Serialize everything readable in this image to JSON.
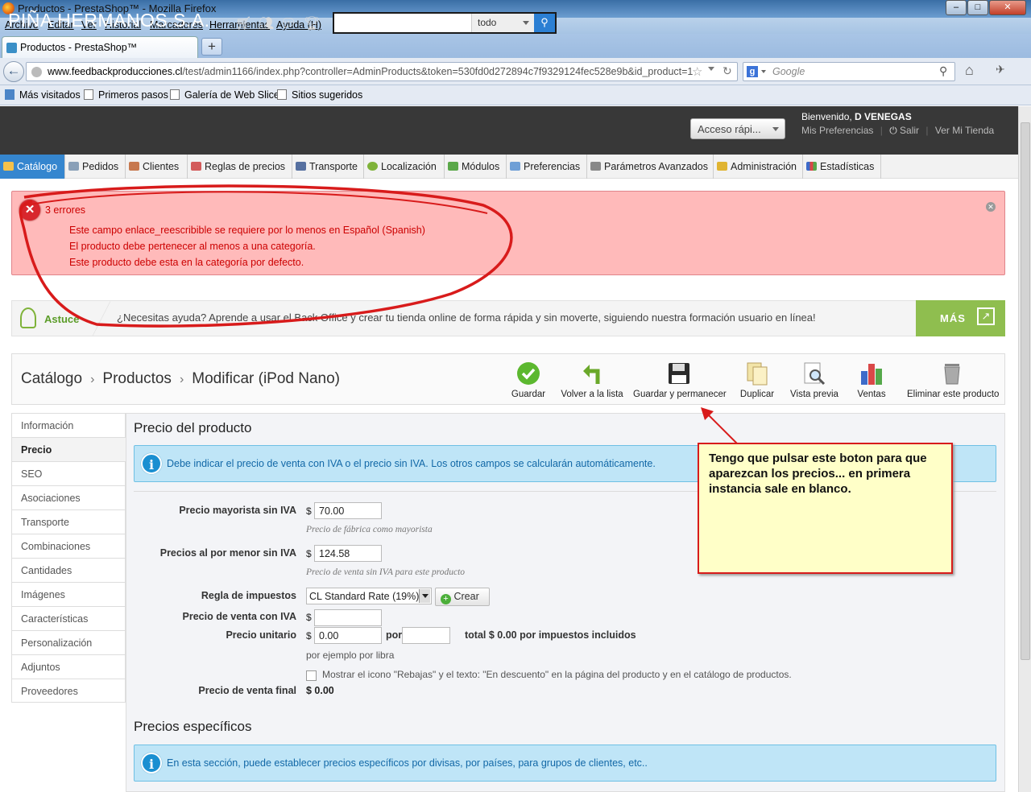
{
  "window": {
    "title": "Productos - PrestaShop™ - Mozilla Firefox"
  },
  "menu": [
    "Archivo",
    "Editar",
    "Ver",
    "Historial",
    "Marcadores",
    "Herramientas",
    "Ayuda (H)"
  ],
  "tab": {
    "label": "Productos - PrestaShop™",
    "new_tab": "+"
  },
  "url": {
    "host": "www.feedbackproducciones.cl",
    "path": "/test/admin1166/index.php?controller=AdminProducts&token=530fd0d272894c7f9329124fec528e9b&id_product=1"
  },
  "search": {
    "placeholder": "Google",
    "engine": "g"
  },
  "bookmarks": [
    "Más visitados",
    "Primeros pasos",
    "Galería de Web Slice",
    "Sitios sugeridos"
  ],
  "header": {
    "shop": "PIÑA HERMANOS S.A.",
    "search_scope": "todo",
    "quick_access": "Acceso rápi...",
    "welcome_prefix": "Bienvenido, ",
    "user": "D VENEGAS",
    "prefs": "Mis Preferencias",
    "logout": "Salir",
    "view_store": "Ver Mi Tienda"
  },
  "nav": [
    "Catálogo",
    "Pedidos",
    "Clientes",
    "Reglas de precios",
    "Transporte",
    "Localización",
    "Módulos",
    "Preferencias",
    "Parámetros Avanzados",
    "Administración",
    "Estadísticas"
  ],
  "errors": {
    "title": "3 errores",
    "items": [
      "Este campo enlace_reescribible se requiere por lo menos en Español (Spanish)",
      "El producto debe pertenecer al menos a una categoría.",
      "Este producto debe esta en la categoría por defecto."
    ]
  },
  "tip": {
    "label": "Astuce",
    "text": "¿Necesitas ayuda? Aprende a usar el Back Office y crear tu tienda online de forma rápida y sin moverte, siguiendo nuestra formación usuario en línea!",
    "more": "MÁS"
  },
  "breadcrumb": [
    "Catálogo",
    "Productos",
    "Modificar (iPod Nano)"
  ],
  "toolbar": [
    "Guardar",
    "Volver a la lista",
    "Guardar y permanecer",
    "Duplicar",
    "Vista previa",
    "Ventas",
    "Eliminar este producto"
  ],
  "side_tabs": [
    "Información",
    "Precio",
    "SEO",
    "Asociaciones",
    "Transporte",
    "Combinaciones",
    "Cantidades",
    "Imágenes",
    "Características",
    "Personalización",
    "Adjuntos",
    "Proveedores"
  ],
  "price": {
    "title": "Precio del producto",
    "info": "Debe indicar el precio de venta con IVA o el precio sin IVA. Los otros campos se calcularán automáticamente.",
    "wholesale_label": "Precio mayorista sin IVA",
    "currency": "$",
    "wholesale": "70.00",
    "wholesale_hint": "Precio de fábrica como mayorista",
    "retail_label": "Precios al por menor sin IVA",
    "retail": "124.58",
    "retail_hint": "Precio de venta sin IVA para este producto",
    "tax_label": "Regla de impuestos",
    "tax_rule": "CL Standard Rate (19%)",
    "create": "Crear",
    "with_tax_label": "Precio de venta con IVA",
    "with_tax": "",
    "unit_label": "Precio unitario",
    "unit": "0.00",
    "per": "por",
    "unit_total": "total $ 0.00 por impuestos incluidos",
    "unit_hint": "por ejemplo por libra",
    "onsale_text": "Mostrar el icono \"Rebajas\" y el texto: \"En descuento\" en la página del producto y en el catálogo de productos.",
    "final_label": "Precio de venta final",
    "final": "$ 0.00"
  },
  "specific": {
    "title": "Precios específicos",
    "info": "En esta sección, puede establecer precios específicos por divisas, por países, para grupos de clientes, etc.."
  },
  "callout": "Tengo que pulsar este boton para que aparezcan los precios... en primera instancia sale en blanco.",
  "colors": {
    "accent": "#3586cf",
    "error_bg": "#ffbaba",
    "error_text": "#cc0000",
    "info_bg": "#bfe5f7",
    "callout_border": "#d81b1b"
  }
}
